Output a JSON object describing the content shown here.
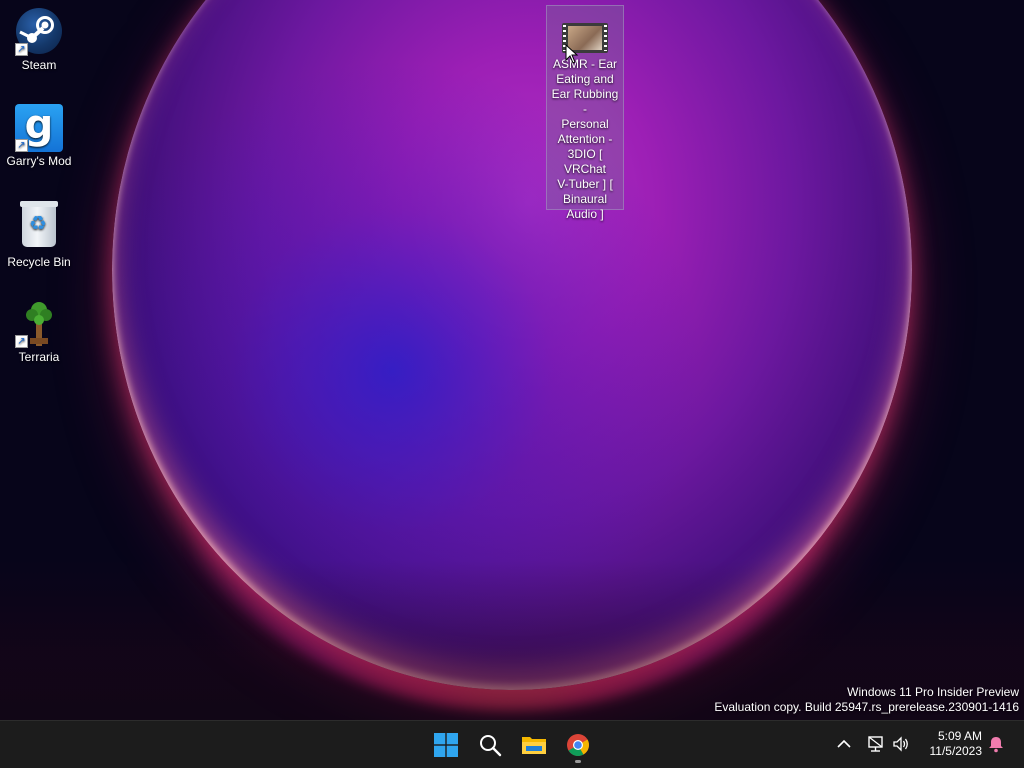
{
  "desktop": {
    "icons": [
      {
        "label": "Steam",
        "icon": "steam-icon"
      },
      {
        "label": "Garry's Mod",
        "icon": "garrys-mod-icon",
        "glyph": "g"
      },
      {
        "label": "Recycle Bin",
        "icon": "recycle-bin-icon"
      },
      {
        "label": "Terraria",
        "icon": "terraria-icon"
      }
    ],
    "selected_file": {
      "label": "ASMR - Ear Eating and Ear Rubbing - Personal Attention - 3DIO [ VRChat V-Tuber ] [ Binaural Audio ]",
      "label_lines": [
        "ASMR - Ear",
        "Eating and",
        "Ear Rubbing -",
        "Personal",
        "Attention -",
        "3DIO [",
        "VRChat",
        "V-Tuber ] [",
        "Binaural",
        "Audio ]"
      ],
      "icon": "video-file-icon"
    }
  },
  "watermark": {
    "line1": "Windows 11 Pro Insider Preview",
    "line2": "Evaluation copy. Build 25947.rs_prerelease.230901-1416"
  },
  "taskbar": {
    "apps": [
      {
        "name": "Start",
        "icon": "windows-start-icon"
      },
      {
        "name": "Search",
        "icon": "search-icon"
      },
      {
        "name": "File Explorer",
        "icon": "folder-icon"
      },
      {
        "name": "Google Chrome",
        "icon": "chrome-icon",
        "running": true
      }
    ],
    "tray": {
      "icons": [
        "chevron-up-icon",
        "network-icon",
        "volume-icon",
        "notification-bell-icon"
      ],
      "time": "5:09 AM",
      "date": "11/5/2023"
    }
  },
  "colors": {
    "taskbar_bg": "#1c1c1c",
    "start_blue": "#2fa5ef",
    "notification": "#f07cae"
  }
}
